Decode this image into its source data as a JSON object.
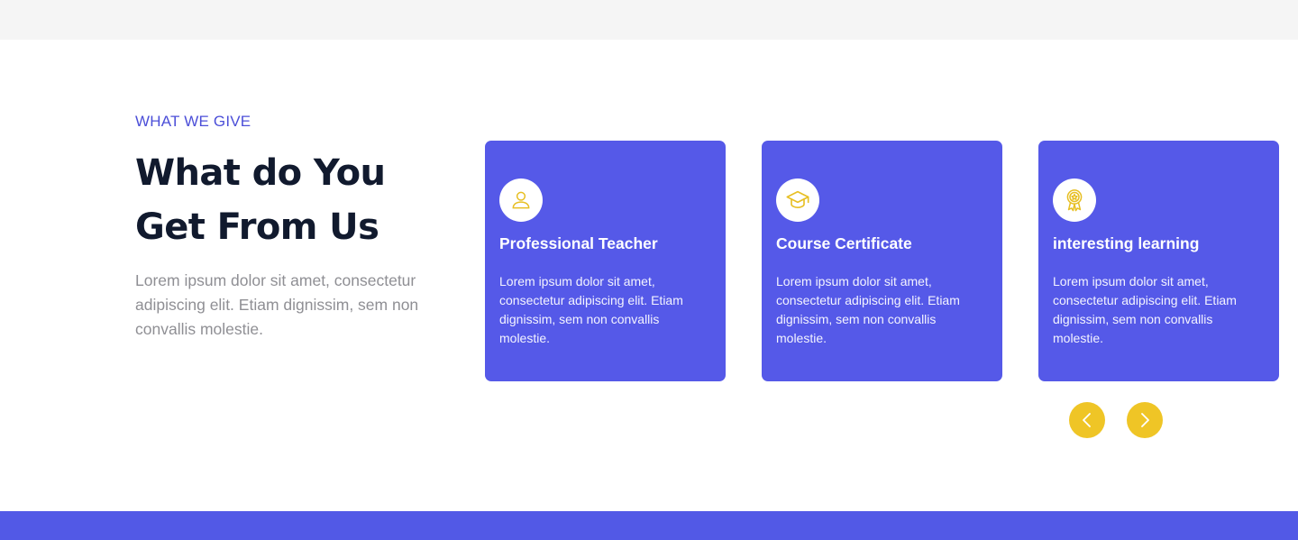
{
  "section": {
    "eyebrow": "WHAT WE GIVE",
    "heading_line_1": "What do You",
    "heading_line_2": "Get From Us",
    "intro": "Lorem ipsum dolor sit amet, consectetur adipiscing elit. Etiam dignissim, sem non convallis molestie."
  },
  "cards": [
    {
      "icon": "user-icon",
      "title": "Professional Teacher",
      "text": "Lorem ipsum dolor sit amet, consectetur adipiscing elit. Etiam dignissim, sem non convallis molestie."
    },
    {
      "icon": "graduation-cap-icon",
      "title": "Course Certificate",
      "text": "Lorem ipsum dolor sit amet, consectetur adipiscing elit. Etiam dignissim, sem non convallis molestie."
    },
    {
      "icon": "award-badge-icon",
      "title": "interesting learning",
      "text": "Lorem ipsum dolor sit amet, consectetur adipiscing elit. Etiam dignissim, sem non convallis molestie."
    }
  ],
  "carousel": {
    "prev_icon": "chevron-left-icon",
    "next_icon": "chevron-right-icon"
  },
  "colors": {
    "accent": "#5559e8",
    "eyebrow": "#4c4fd8",
    "heading": "#111a2e",
    "body_text": "#8f8f94",
    "icon_gold": "#e7bf23",
    "nav_button": "#efc526",
    "top_band": "#f5f5f5",
    "bottom_band": "#5259e6"
  }
}
